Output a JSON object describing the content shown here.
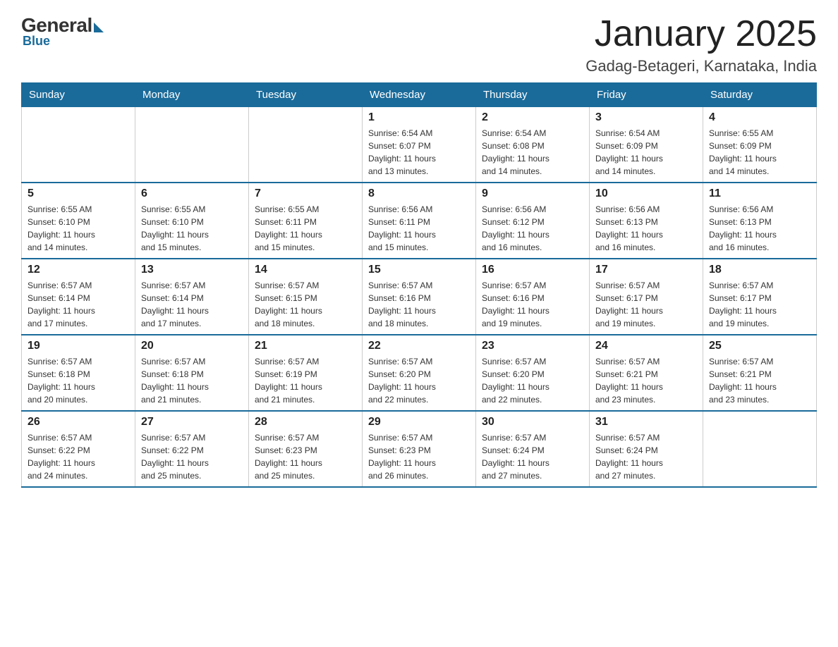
{
  "logo": {
    "general": "General",
    "blue": "Blue"
  },
  "header": {
    "title": "January 2025",
    "subtitle": "Gadag-Betageri, Karnataka, India"
  },
  "days_of_week": [
    "Sunday",
    "Monday",
    "Tuesday",
    "Wednesday",
    "Thursday",
    "Friday",
    "Saturday"
  ],
  "weeks": [
    [
      {
        "day": "",
        "info": ""
      },
      {
        "day": "",
        "info": ""
      },
      {
        "day": "",
        "info": ""
      },
      {
        "day": "1",
        "info": "Sunrise: 6:54 AM\nSunset: 6:07 PM\nDaylight: 11 hours\nand 13 minutes."
      },
      {
        "day": "2",
        "info": "Sunrise: 6:54 AM\nSunset: 6:08 PM\nDaylight: 11 hours\nand 14 minutes."
      },
      {
        "day": "3",
        "info": "Sunrise: 6:54 AM\nSunset: 6:09 PM\nDaylight: 11 hours\nand 14 minutes."
      },
      {
        "day": "4",
        "info": "Sunrise: 6:55 AM\nSunset: 6:09 PM\nDaylight: 11 hours\nand 14 minutes."
      }
    ],
    [
      {
        "day": "5",
        "info": "Sunrise: 6:55 AM\nSunset: 6:10 PM\nDaylight: 11 hours\nand 14 minutes."
      },
      {
        "day": "6",
        "info": "Sunrise: 6:55 AM\nSunset: 6:10 PM\nDaylight: 11 hours\nand 15 minutes."
      },
      {
        "day": "7",
        "info": "Sunrise: 6:55 AM\nSunset: 6:11 PM\nDaylight: 11 hours\nand 15 minutes."
      },
      {
        "day": "8",
        "info": "Sunrise: 6:56 AM\nSunset: 6:11 PM\nDaylight: 11 hours\nand 15 minutes."
      },
      {
        "day": "9",
        "info": "Sunrise: 6:56 AM\nSunset: 6:12 PM\nDaylight: 11 hours\nand 16 minutes."
      },
      {
        "day": "10",
        "info": "Sunrise: 6:56 AM\nSunset: 6:13 PM\nDaylight: 11 hours\nand 16 minutes."
      },
      {
        "day": "11",
        "info": "Sunrise: 6:56 AM\nSunset: 6:13 PM\nDaylight: 11 hours\nand 16 minutes."
      }
    ],
    [
      {
        "day": "12",
        "info": "Sunrise: 6:57 AM\nSunset: 6:14 PM\nDaylight: 11 hours\nand 17 minutes."
      },
      {
        "day": "13",
        "info": "Sunrise: 6:57 AM\nSunset: 6:14 PM\nDaylight: 11 hours\nand 17 minutes."
      },
      {
        "day": "14",
        "info": "Sunrise: 6:57 AM\nSunset: 6:15 PM\nDaylight: 11 hours\nand 18 minutes."
      },
      {
        "day": "15",
        "info": "Sunrise: 6:57 AM\nSunset: 6:16 PM\nDaylight: 11 hours\nand 18 minutes."
      },
      {
        "day": "16",
        "info": "Sunrise: 6:57 AM\nSunset: 6:16 PM\nDaylight: 11 hours\nand 19 minutes."
      },
      {
        "day": "17",
        "info": "Sunrise: 6:57 AM\nSunset: 6:17 PM\nDaylight: 11 hours\nand 19 minutes."
      },
      {
        "day": "18",
        "info": "Sunrise: 6:57 AM\nSunset: 6:17 PM\nDaylight: 11 hours\nand 19 minutes."
      }
    ],
    [
      {
        "day": "19",
        "info": "Sunrise: 6:57 AM\nSunset: 6:18 PM\nDaylight: 11 hours\nand 20 minutes."
      },
      {
        "day": "20",
        "info": "Sunrise: 6:57 AM\nSunset: 6:18 PM\nDaylight: 11 hours\nand 21 minutes."
      },
      {
        "day": "21",
        "info": "Sunrise: 6:57 AM\nSunset: 6:19 PM\nDaylight: 11 hours\nand 21 minutes."
      },
      {
        "day": "22",
        "info": "Sunrise: 6:57 AM\nSunset: 6:20 PM\nDaylight: 11 hours\nand 22 minutes."
      },
      {
        "day": "23",
        "info": "Sunrise: 6:57 AM\nSunset: 6:20 PM\nDaylight: 11 hours\nand 22 minutes."
      },
      {
        "day": "24",
        "info": "Sunrise: 6:57 AM\nSunset: 6:21 PM\nDaylight: 11 hours\nand 23 minutes."
      },
      {
        "day": "25",
        "info": "Sunrise: 6:57 AM\nSunset: 6:21 PM\nDaylight: 11 hours\nand 23 minutes."
      }
    ],
    [
      {
        "day": "26",
        "info": "Sunrise: 6:57 AM\nSunset: 6:22 PM\nDaylight: 11 hours\nand 24 minutes."
      },
      {
        "day": "27",
        "info": "Sunrise: 6:57 AM\nSunset: 6:22 PM\nDaylight: 11 hours\nand 25 minutes."
      },
      {
        "day": "28",
        "info": "Sunrise: 6:57 AM\nSunset: 6:23 PM\nDaylight: 11 hours\nand 25 minutes."
      },
      {
        "day": "29",
        "info": "Sunrise: 6:57 AM\nSunset: 6:23 PM\nDaylight: 11 hours\nand 26 minutes."
      },
      {
        "day": "30",
        "info": "Sunrise: 6:57 AM\nSunset: 6:24 PM\nDaylight: 11 hours\nand 27 minutes."
      },
      {
        "day": "31",
        "info": "Sunrise: 6:57 AM\nSunset: 6:24 PM\nDaylight: 11 hours\nand 27 minutes."
      },
      {
        "day": "",
        "info": ""
      }
    ]
  ]
}
